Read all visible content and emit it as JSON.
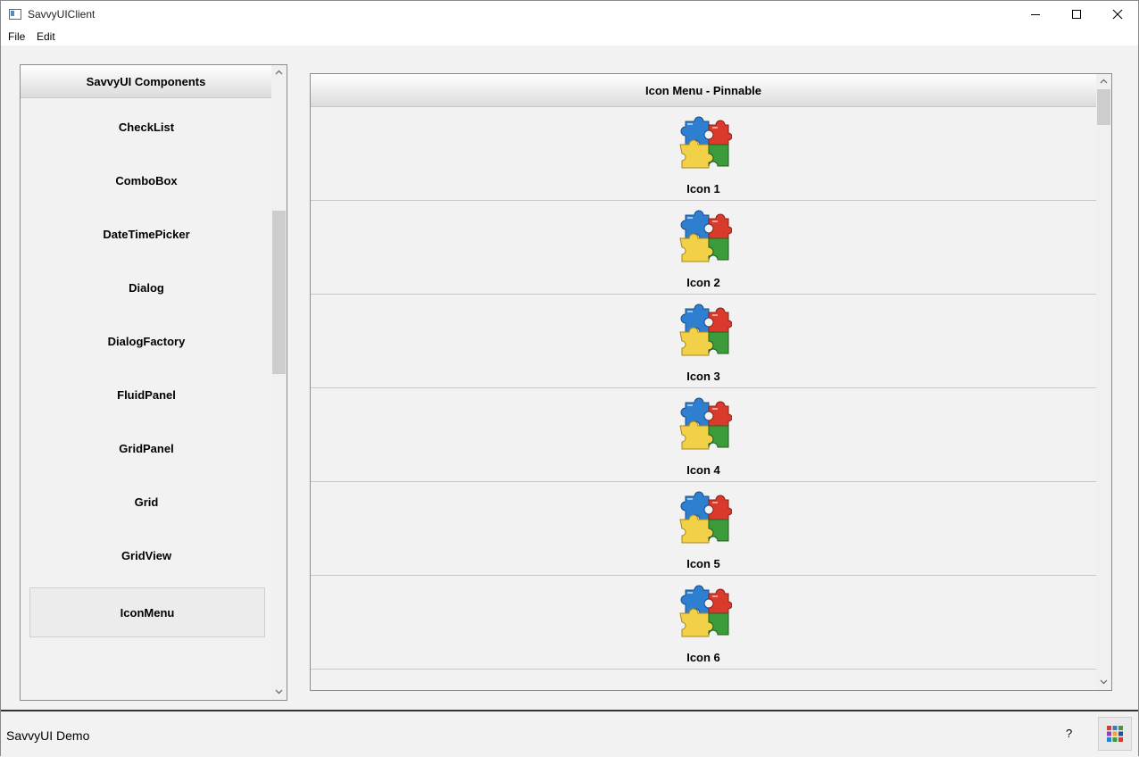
{
  "window": {
    "title": "SavvyUIClient"
  },
  "menubar": {
    "items": [
      "File",
      "Edit"
    ]
  },
  "left_panel": {
    "header": "SavvyUI Components",
    "items": [
      "CheckList",
      "ComboBox",
      "DateTimePicker",
      "Dialog",
      "DialogFactory",
      "FluidPanel",
      "GridPanel",
      "Grid",
      "GridView",
      "IconMenu"
    ],
    "selected": "IconMenu"
  },
  "right_panel": {
    "header": "Icon Menu - Pinnable",
    "items": [
      "Icon 1",
      "Icon 2",
      "Icon 3",
      "Icon 4",
      "Icon 5",
      "Icon 6"
    ]
  },
  "statusbar": {
    "text": "SavvyUI Demo",
    "help": "?"
  },
  "colors": {
    "puzzle_blue": "#2f7fd0",
    "puzzle_red": "#d93a2b",
    "puzzle_green": "#3c9b3a",
    "puzzle_yellow": "#f2d048"
  }
}
